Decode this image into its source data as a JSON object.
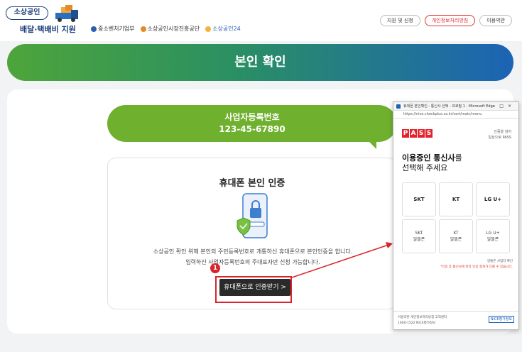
{
  "header": {
    "logo_badge": "소상공인",
    "logo_sub": "배달·택배비 지원",
    "partners": [
      "중소벤처기업부",
      "소상공인시장진흥공단",
      "소상공인24"
    ],
    "top_links": [
      "지원 및 신청",
      "개인정보처리방침",
      "이용약관"
    ],
    "brand_color": "#1d3f7a"
  },
  "banner": {
    "title": "본인 확인"
  },
  "business": {
    "label": "사업자등록번호",
    "number": "123-45-67890"
  },
  "auth": {
    "title": "휴대폰 본인 인증",
    "desc_line1": "소상공인 확인 위해 본인의 주민등록번호로 개통하신 휴대폰으로 본인인증을 합니다.",
    "desc_line2": "입력하신 사업자등록번호의 주대표자만 신청 가능합니다.",
    "button": "휴대폰으로 인증받기 >",
    "step": "1"
  },
  "popup": {
    "window_title": "휴대폰 본인확인 - 통신사 선택 - 프로필 1 - Microsoft Edge",
    "url": "https://nice.checkplus.co.kr/cert/main/menu",
    "pass_letters": [
      "P",
      "A",
      "S",
      "S"
    ],
    "side_line1": "인증을 넘어",
    "side_line2": "일상으로 PASS",
    "heading_bold": "이용중인 통신사",
    "heading_rest": "를",
    "heading_line2": "선택해 주세요",
    "carriers": [
      {
        "name": "SKT",
        "sub": ""
      },
      {
        "name": "KT",
        "sub": ""
      },
      {
        "name": "LG U+",
        "sub": ""
      },
      {
        "name": "SKT",
        "sub": "알뜰폰"
      },
      {
        "name": "KT",
        "sub": "알뜰폰"
      },
      {
        "name": "LG U+",
        "sub": "알뜰폰"
      }
    ],
    "note1": "알뜰폰 사업자 확인",
    "note2": "*인증 후 통신사에 따라 인증 절차가 다를 수 있습니다.",
    "footer_line1": "이용약관 개인정보처리방침 고객센터",
    "footer_line2": "1600-1522 NICE평가정보",
    "footer_badge": "NICE평가정보"
  }
}
